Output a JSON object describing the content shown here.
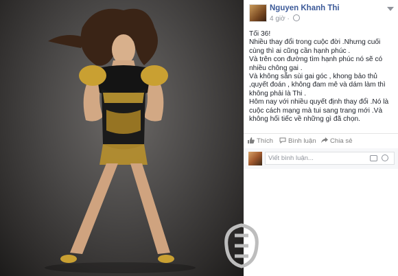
{
  "photo": {
    "alt": ""
  },
  "post": {
    "author": "Nguyen Khanh Thi",
    "time": "4 giờ ·",
    "paragraphs": [
      "Tối 36!",
      "Nhiều thay đổi trong cuộc đời .Nhưng cuối cùng thì ai cũng cần hạnh phúc .",
      "Và trên con đường tìm hạnh phúc nó sẽ có nhiều chông gai .",
      "Và không sẵn sùi gai góc , khong bảo thủ ,quyết đoán , không đam mê và dám làm thì không phải là Thi .",
      "Hôm nay với nhiều quyết định thay đổi .Nó là cuộc cách mạng mà tui sang trang mới .Và không hối tiếc về những gì đã chọn."
    ]
  },
  "actions": {
    "like": "Thích",
    "comment": "Bình luận",
    "share": "Chia sẻ"
  },
  "comment_box": {
    "placeholder": "Viết bình luận..."
  },
  "colors": {
    "link": "#3b5998",
    "text": "#1d2129",
    "muted": "#90949c",
    "gold": "#c9a032"
  }
}
